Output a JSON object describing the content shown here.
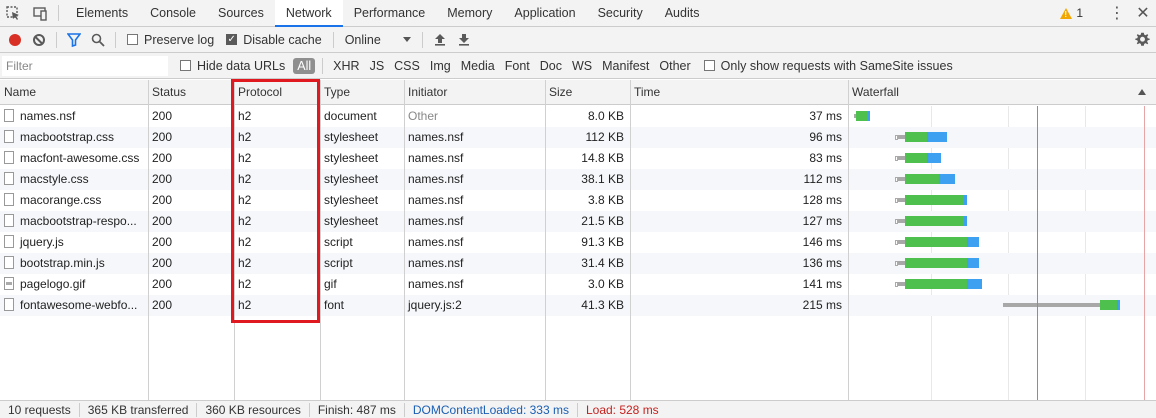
{
  "tabs": [
    "Elements",
    "Console",
    "Sources",
    "Network",
    "Performance",
    "Memory",
    "Application",
    "Security",
    "Audits"
  ],
  "active_tab": "Network",
  "warnings_count": "1",
  "toolbar": {
    "preserve_log_label": "Preserve log",
    "preserve_log_checked": false,
    "disable_cache_label": "Disable cache",
    "disable_cache_checked": true,
    "throttle_value": "Online"
  },
  "filterbar": {
    "filter_placeholder": "Filter",
    "hide_data_urls_label": "Hide data URLs",
    "types": [
      "All",
      "XHR",
      "JS",
      "CSS",
      "Img",
      "Media",
      "Font",
      "Doc",
      "WS",
      "Manifest",
      "Other"
    ],
    "active_type": "All",
    "samesite_label": "Only show requests with SameSite issues"
  },
  "columns": {
    "name": "Name",
    "status": "Status",
    "protocol": "Protocol",
    "type": "Type",
    "initiator": "Initiator",
    "size": "Size",
    "time": "Time",
    "waterfall": "Waterfall"
  },
  "requests": [
    {
      "name": "names.nsf",
      "status": "200",
      "protocol": "h2",
      "type": "document",
      "initiator": "Other",
      "initiator_link": false,
      "size": "8.0 KB",
      "time": "37 ms",
      "icon": "file"
    },
    {
      "name": "macbootstrap.css",
      "status": "200",
      "protocol": "h2",
      "type": "stylesheet",
      "initiator": "names.nsf",
      "initiator_link": true,
      "size": "112 KB",
      "time": "96 ms",
      "icon": "file"
    },
    {
      "name": "macfont-awesome.css",
      "status": "200",
      "protocol": "h2",
      "type": "stylesheet",
      "initiator": "names.nsf",
      "initiator_link": true,
      "size": "14.8 KB",
      "time": "83 ms",
      "icon": "file"
    },
    {
      "name": "macstyle.css",
      "status": "200",
      "protocol": "h2",
      "type": "stylesheet",
      "initiator": "names.nsf",
      "initiator_link": true,
      "size": "38.1 KB",
      "time": "112 ms",
      "icon": "file"
    },
    {
      "name": "macorange.css",
      "status": "200",
      "protocol": "h2",
      "type": "stylesheet",
      "initiator": "names.nsf",
      "initiator_link": true,
      "size": "3.8 KB",
      "time": "128 ms",
      "icon": "file"
    },
    {
      "name": "macbootstrap-respo...",
      "status": "200",
      "protocol": "h2",
      "type": "stylesheet",
      "initiator": "names.nsf",
      "initiator_link": true,
      "size": "21.5 KB",
      "time": "127 ms",
      "icon": "file"
    },
    {
      "name": "jquery.js",
      "status": "200",
      "protocol": "h2",
      "type": "script",
      "initiator": "names.nsf",
      "initiator_link": true,
      "size": "91.3 KB",
      "time": "146 ms",
      "icon": "file"
    },
    {
      "name": "bootstrap.min.js",
      "status": "200",
      "protocol": "h2",
      "type": "script",
      "initiator": "names.nsf",
      "initiator_link": true,
      "size": "31.4 KB",
      "time": "136 ms",
      "icon": "file"
    },
    {
      "name": "pagelogo.gif",
      "status": "200",
      "protocol": "h2",
      "type": "gif",
      "initiator": "names.nsf",
      "initiator_link": true,
      "size": "3.0 KB",
      "time": "141 ms",
      "icon": "image"
    },
    {
      "name": "fontawesome-webfo...",
      "status": "200",
      "protocol": "h2",
      "type": "font",
      "initiator": "jquery.js:2",
      "initiator_link": true,
      "size": "41.3 KB",
      "time": "215 ms",
      "icon": "file"
    }
  ],
  "waterfall_ms": [
    {
      "start": 0,
      "queue": 0,
      "wait": 3,
      "download_green": 22,
      "download_blue": 4
    },
    {
      "start": 75,
      "queue": 5,
      "wait": 12,
      "download_green": 40,
      "download_blue": 38
    },
    {
      "start": 75,
      "queue": 5,
      "wait": 12,
      "download_green": 40,
      "download_blue": 26
    },
    {
      "start": 75,
      "queue": 5,
      "wait": 12,
      "download_green": 62,
      "download_blue": 30
    },
    {
      "start": 75,
      "queue": 5,
      "wait": 12,
      "download_green": 108,
      "download_blue": 5
    },
    {
      "start": 75,
      "queue": 5,
      "wait": 12,
      "download_green": 108,
      "download_blue": 5
    },
    {
      "start": 75,
      "queue": 5,
      "wait": 12,
      "download_green": 113,
      "download_blue": 22
    },
    {
      "start": 75,
      "queue": 5,
      "wait": 12,
      "download_green": 113,
      "download_blue": 22
    },
    {
      "start": 75,
      "queue": 5,
      "wait": 12,
      "download_green": 113,
      "download_blue": 28
    },
    {
      "start": 270,
      "queue": 0,
      "wait": 178,
      "download_green": 30,
      "download_blue": 6
    }
  ],
  "timeline": {
    "dom_content_loaded_ms": 333,
    "load_ms": 528,
    "max_ms": 560
  },
  "status": {
    "requests": "10 requests",
    "transferred": "365 KB transferred",
    "resources": "360 KB resources",
    "finish": "Finish: 487 ms",
    "dcl": "DOMContentLoaded: 333 ms",
    "load": "Load: 528 ms"
  },
  "colors": {
    "accent": "#1a73e8",
    "record": "#d93025",
    "highlight": "#e0181f",
    "bar_green": "#4ec04e",
    "bar_blue": "#3ea0f0"
  }
}
